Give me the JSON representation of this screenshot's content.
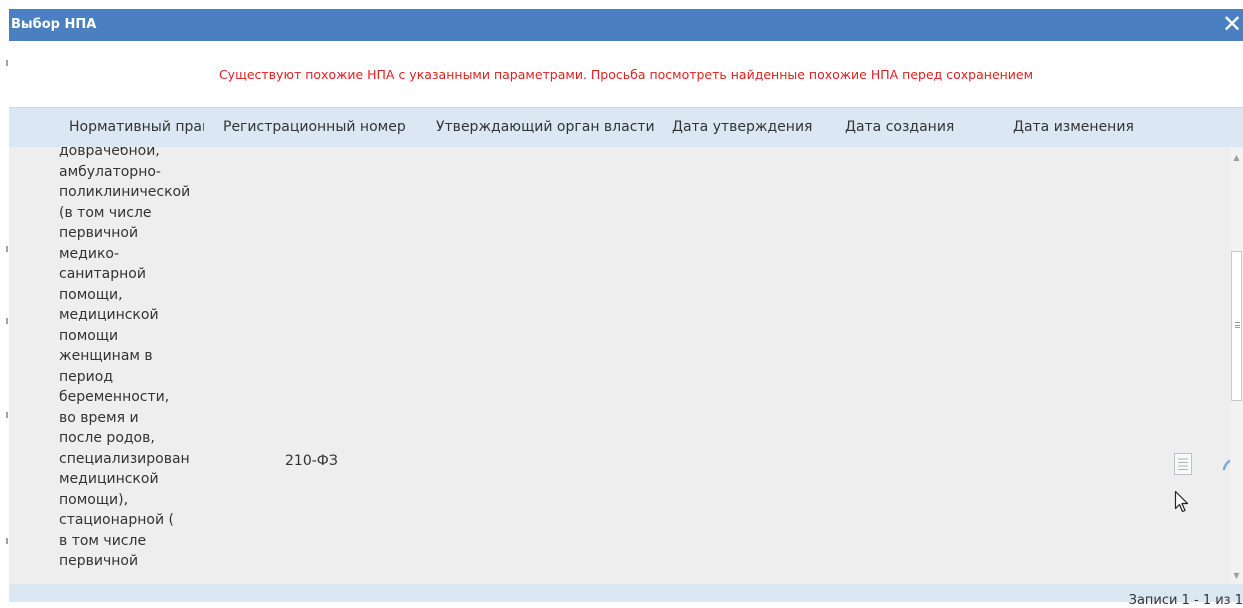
{
  "dialog": {
    "title": "Выбор НПА",
    "close_glyph": "✕",
    "warning": "Существуют похожие НПА с указанными параметрами. Просьба посмотреть найденные похожие НПА перед сохранением"
  },
  "table": {
    "columns": [
      "Нормативный прав",
      "Регистрационный номер",
      "Утверждающий орган власти",
      "Дата утверждения",
      "Дата создания",
      "Дата изменения"
    ],
    "rows": [
      {
        "name": "доврачебной,\nамбулаторно-\nполиклинической\n(в том числе\nпервичной\nмедико-\nсанитарной\nпомощи,\nмедицинской\nпомощи\nженщинам в\nпериод\nбеременности,\nво время и\nпосле родов,\nспециализирован\nмедицинской\nпомощи),\nстационарной (\nв том числе\nпервичной",
        "reg_number": "210-ФЗ"
      }
    ]
  },
  "icons": {
    "view": "document-icon",
    "open": "link-arrow-icon",
    "cursor": "mouse-pointer-icon"
  },
  "colors": {
    "titlebar": "#4a7fc1",
    "warning_text": "#e02020",
    "header_bg": "#dbe8f4",
    "body_bg": "#eeeeee"
  },
  "footer": {
    "records": "Записи 1 - 1 из 1"
  }
}
